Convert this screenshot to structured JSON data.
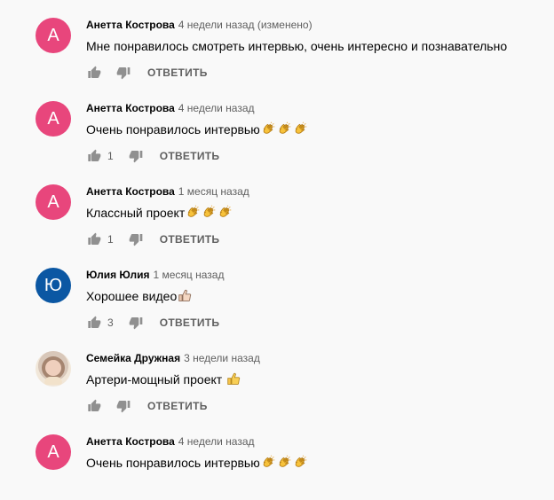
{
  "comments": [
    {
      "author": "Анетта Кострова",
      "time": "4 недели назад (изменено)",
      "text": "Мне понравилось смотреть интервью, очень интересно и познавательно",
      "likes": "",
      "avatar_letter": "А",
      "avatar_color": "#e8467c",
      "emoji": []
    },
    {
      "author": "Анетта Кострова",
      "time": "4 недели назад",
      "text": "Очень понравилось интервью",
      "likes": "1",
      "avatar_letter": "А",
      "avatar_color": "#e8467c",
      "emoji": [
        "clap-emoji",
        "clap-emoji",
        "clap-emoji"
      ]
    },
    {
      "author": "Анетта Кострова",
      "time": "1 месяц назад",
      "text": "Классный проект",
      "likes": "1",
      "avatar_letter": "А",
      "avatar_color": "#e8467c",
      "emoji": [
        "clap-emoji",
        "clap-emoji",
        "clap-emoji"
      ]
    },
    {
      "author": "Юлия Юлия",
      "time": "1 месяц назад",
      "text": "Хорошее видео",
      "likes": "3",
      "avatar_letter": "Ю",
      "avatar_color": "#0b57a3",
      "emoji": [
        "thumbs-up-light-emoji"
      ]
    },
    {
      "author": "Семейка Дружная",
      "time": "3 недели назад",
      "text": "Артери-мощный проект ",
      "likes": "",
      "avatar_letter": "",
      "avatar_color": "",
      "emoji": [
        "thumbs-up-yellow-emoji"
      ]
    },
    {
      "author": "Анетта Кострова",
      "time": "4 недели назад",
      "text": "Очень понравилось интервью",
      "likes": "",
      "avatar_letter": "А",
      "avatar_color": "#e8467c",
      "emoji": [
        "clap-emoji",
        "clap-emoji",
        "clap-emoji"
      ]
    }
  ],
  "labels": {
    "reply": "ОТВЕТИТЬ"
  },
  "icons": {
    "like": "thumbs-up-icon",
    "dislike": "thumbs-down-icon"
  },
  "colors": {
    "background": "#f9f9f9",
    "author": "#030303",
    "meta": "#606060",
    "icon": "#909090"
  }
}
